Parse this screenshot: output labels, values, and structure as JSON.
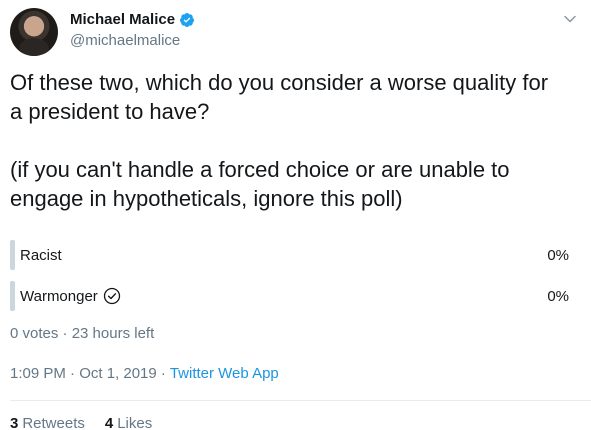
{
  "author": {
    "display_name": "Michael Malice",
    "handle": "@michaelmalice",
    "verified": true
  },
  "tweet": {
    "text_line1": "Of these two, which do you consider a worse quality for",
    "text_line2": "a president to have?",
    "text_line3": "(if you can't handle a forced choice or are unable to",
    "text_line4": "engage in hypotheticals, ignore this poll)"
  },
  "poll": {
    "options": [
      {
        "label": "Racist",
        "percent": "0%",
        "selected": false
      },
      {
        "label": "Warmonger",
        "percent": "0%",
        "selected": true
      }
    ],
    "meta": "0 votes · 23 hours left"
  },
  "timestamp": {
    "time_date": "1:09 PM · Oct 1, 2019 · ",
    "app": "Twitter Web App"
  },
  "stats": {
    "retweets_count": "3",
    "retweets_label": "Retweets",
    "likes_count": "4",
    "likes_label": "Likes"
  },
  "colors": {
    "accent": "#1b95e0",
    "verified": "#1da1f2",
    "muted": "#657786",
    "bar": "#ccd6dd"
  },
  "icons": {
    "verified": "verified-badge-icon",
    "more": "chevron-down-icon",
    "selected": "check-circle-icon"
  }
}
